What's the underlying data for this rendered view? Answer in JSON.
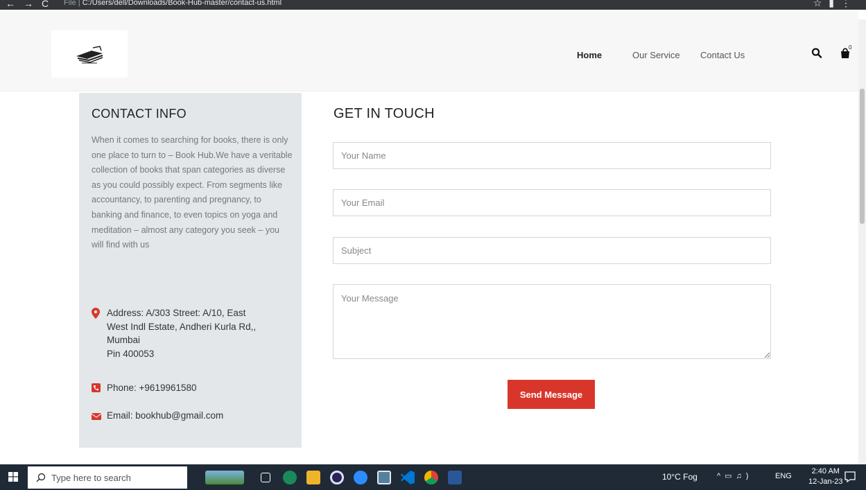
{
  "browser": {
    "url_prefix": "File |",
    "url": "C:/Users/dell/Downloads/Book-Hub-master/contact-us.html"
  },
  "header": {
    "nav": [
      {
        "label": "Home",
        "active": true
      },
      {
        "label": "Our Service",
        "active": false
      },
      {
        "label": "Contact Us",
        "active": false
      }
    ],
    "cart_count": "0"
  },
  "contact_info": {
    "title": "CONTACT INFO",
    "description": "When it comes to searching for books, there is only one place to turn to – Book Hub.We have a veritable collection of books that span categories as diverse as you could possibly expect. From segments like accountancy, to parenting and pregnancy, to banking and finance, to even topics on yoga and meditation – almost any category you seek – you will find with us",
    "address_line1": "Address: A/303 Street: A/10, East",
    "address_line2": "West Indl Estate, Andheri Kurla Rd,,",
    "address_line3": "Mumbai",
    "address_line4": "Pin 400053",
    "phone": "Phone: +9619961580",
    "email": "Email: bookhub@gmail.com",
    "accent_color": "#d9362b"
  },
  "form": {
    "title": "GET IN TOUCH",
    "name_placeholder": "Your Name",
    "email_placeholder": "Your Email",
    "subject_placeholder": "Subject",
    "message_placeholder": "Your Message",
    "submit_label": "Send Message"
  },
  "taskbar": {
    "search_placeholder": "Type here to search",
    "weather": "10°C Fog",
    "language": "ENG",
    "time": "2:40 AM",
    "date": "12-Jan-23"
  }
}
